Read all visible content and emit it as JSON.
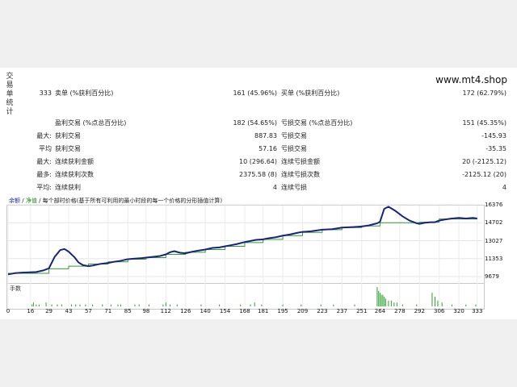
{
  "header": {
    "side_label": [
      "交",
      "易",
      "单",
      "统",
      "计"
    ],
    "site": "www.mt4.shop"
  },
  "stats": {
    "total_trades": "333",
    "short_label": "卖单 (%获利百分比)",
    "short_value": "161 (45.96%)",
    "long_label": "买单 (%获利百分比)",
    "long_value": "172 (62.79%)",
    "profit_trades_label": "盈利交易 (%点总百分比)",
    "profit_trades_value": "182 (54.65%)",
    "loss_trades_label": "亏损交易 (%点总百分比)",
    "loss_trades_value": "151 (45.35%)",
    "rows": [
      {
        "prefix": "最大:",
        "l_label": "获利交易",
        "l_value": "887.83",
        "r_label": "亏损交易",
        "r_value": "-145.93"
      },
      {
        "prefix": "平均",
        "l_label": "获利交易",
        "l_value": "57.16",
        "r_label": "亏损交易",
        "r_value": "-35.35"
      },
      {
        "prefix": "最大:",
        "l_label": "连续获利金额",
        "l_value": "10 (296.64)",
        "r_label": "连续亏损金额",
        "r_value": "20 (-2125.12)"
      },
      {
        "prefix": "最多:",
        "l_label": "连续获利次数",
        "l_value": "2375.58 (8)",
        "r_label": "连续亏损次数",
        "r_value": "-2125.12 (20)"
      },
      {
        "prefix": "平均:",
        "l_label": "连续获利",
        "l_value": "4",
        "r_label": "连续亏损",
        "r_value": "4"
      }
    ]
  },
  "legend": {
    "balance": "余额",
    "sep": "/",
    "equity": "净值",
    "desc": "/ 每个部时价格(基于所有可利用的最小时段的每一个价格的分形插值计算)"
  },
  "volume_label": "手数",
  "colors": {
    "balance": "#1a237e",
    "equity": "#2e9e2e",
    "volume": "#2e9e2e"
  },
  "chart_data": {
    "type": "line",
    "y_ticks": [
      9679,
      11353,
      13027,
      14702,
      16376
    ],
    "ylim": [
      9679,
      16376
    ],
    "x_ticks": [
      0,
      16,
      29,
      43,
      57,
      71,
      85,
      98,
      112,
      126,
      140,
      154,
      168,
      181,
      195,
      209,
      223,
      237,
      251,
      264,
      278,
      292,
      306,
      320,
      333
    ],
    "xlim": [
      0,
      336
    ],
    "series": [
      {
        "name": "余额",
        "x": [
          0,
          5,
          10,
          15,
          20,
          25,
          29,
          33,
          37,
          40,
          43,
          47,
          50,
          53,
          57,
          60,
          65,
          71,
          75,
          80,
          85,
          90,
          95,
          98,
          105,
          108,
          112,
          115,
          118,
          122,
          126,
          131,
          135,
          140,
          145,
          150,
          154,
          158,
          162,
          168,
          172,
          176,
          181,
          185,
          190,
          195,
          200,
          205,
          209,
          215,
          220,
          223,
          230,
          235,
          237,
          245,
          251,
          256,
          259,
          262,
          264,
          267,
          270,
          275,
          280,
          285,
          290,
          292,
          296,
          300,
          303,
          306,
          310,
          315,
          320,
          325,
          330,
          333
        ],
        "values": [
          9880,
          10000,
          10050,
          10070,
          10100,
          10250,
          10450,
          11500,
          12150,
          12250,
          12000,
          11500,
          11000,
          10750,
          10650,
          10700,
          10850,
          10950,
          11050,
          11150,
          11300,
          11350,
          11400,
          11450,
          11550,
          11600,
          11750,
          11950,
          12050,
          11900,
          11850,
          12000,
          12100,
          12200,
          12350,
          12400,
          12500,
          12600,
          12700,
          12900,
          13000,
          13100,
          13150,
          13250,
          13350,
          13500,
          13600,
          13750,
          13850,
          13900,
          14000,
          14050,
          14100,
          14200,
          14250,
          14300,
          14350,
          14450,
          14550,
          14650,
          14800,
          16000,
          16200,
          15800,
          15300,
          14900,
          14650,
          14600,
          14700,
          14750,
          14750,
          14900,
          15000,
          15100,
          15150,
          15100,
          15150,
          15100
        ]
      },
      {
        "name": "净值",
        "x": [
          0,
          29,
          29,
          43,
          43,
          57,
          57,
          71,
          71,
          85,
          85,
          98,
          98,
          112,
          112,
          126,
          126,
          140,
          140,
          154,
          154,
          168,
          168,
          181,
          181,
          195,
          195,
          209,
          209,
          223,
          223,
          237,
          237,
          251,
          251,
          264,
          264,
          292,
          292,
          306,
          306,
          333
        ],
        "values": [
          9980,
          9980,
          10400,
          10400,
          10650,
          10650,
          10850,
          10850,
          11050,
          11050,
          11300,
          11300,
          11450,
          11450,
          11750,
          11750,
          11950,
          11950,
          12200,
          12200,
          12500,
          12500,
          12850,
          12850,
          13150,
          13150,
          13500,
          13500,
          13800,
          13800,
          14050,
          14050,
          14250,
          14250,
          14400,
          14400,
          14700,
          14700,
          14750,
          14750,
          15050,
          15050
        ]
      }
    ],
    "volume": {
      "x": [
        17,
        18,
        20,
        22,
        27,
        31,
        35,
        38,
        45,
        48,
        51,
        55,
        60,
        67,
        73,
        78,
        80,
        90,
        93,
        100,
        110,
        112,
        115,
        120,
        137,
        150,
        165,
        172,
        175,
        180,
        195,
        208,
        222,
        231,
        246,
        262,
        263,
        264,
        265,
        266,
        267,
        268,
        270,
        272,
        274,
        276,
        280,
        290,
        301,
        303,
        305,
        308,
        315,
        325,
        332
      ],
      "values": [
        1,
        2,
        1,
        1,
        2,
        1,
        1,
        1,
        1,
        1,
        1,
        1,
        1,
        1,
        1,
        1,
        1,
        1,
        1,
        1,
        1,
        2,
        1,
        1,
        1,
        1,
        1,
        1,
        2,
        1,
        1,
        1,
        1,
        1,
        1,
        10,
        8,
        7,
        6,
        6,
        5,
        4,
        3,
        3,
        2,
        2,
        1,
        1,
        7,
        5,
        3,
        2,
        1,
        1,
        1
      ]
    }
  }
}
